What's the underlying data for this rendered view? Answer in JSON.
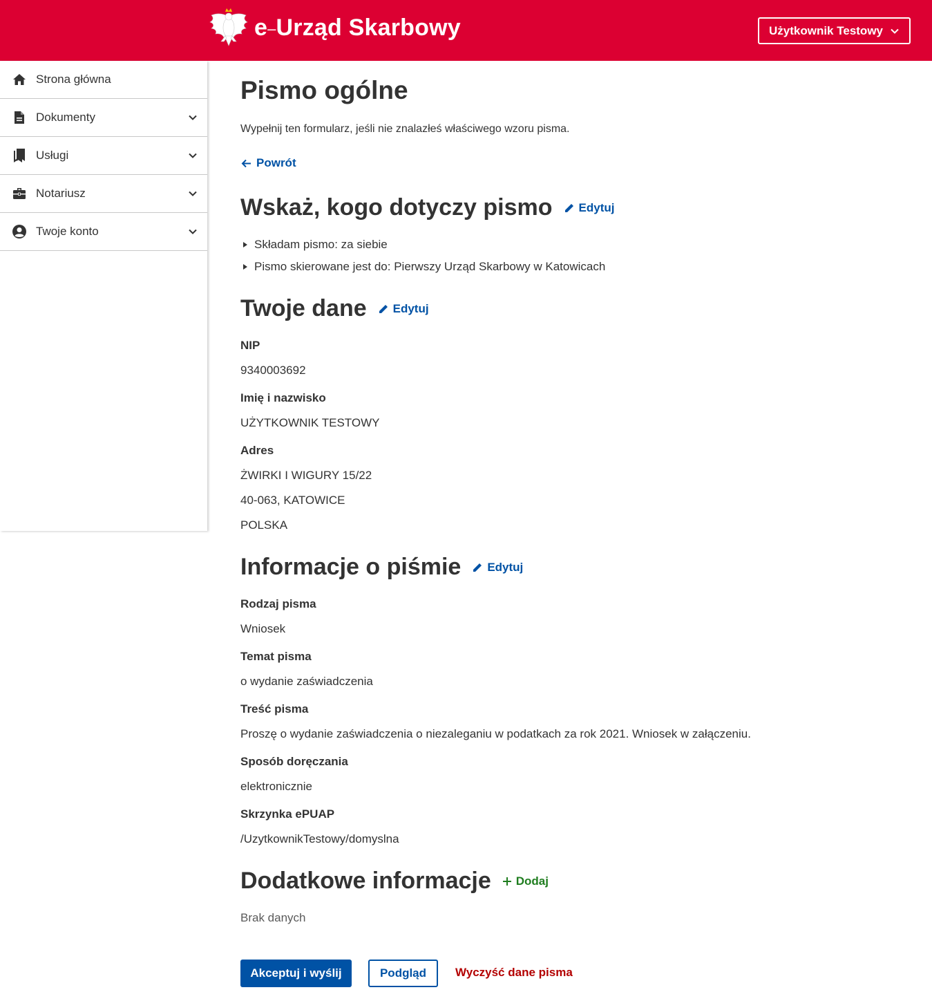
{
  "header": {
    "brand_prefix": "e",
    "brand_dash": "–",
    "brand_name": "Urząd Skarbowy",
    "user_button_label": "Użytkownik Testowy",
    "brand_color": "#dc0032"
  },
  "sidebar": {
    "items": [
      {
        "label": "Strona główna",
        "icon": "home-icon",
        "expandable": false
      },
      {
        "label": "Dokumenty",
        "icon": "document-icon",
        "expandable": true
      },
      {
        "label": "Usługi",
        "icon": "bookmarks-icon",
        "expandable": true
      },
      {
        "label": "Notariusz",
        "icon": "briefcase-icon",
        "expandable": true
      },
      {
        "label": "Twoje konto",
        "icon": "account-icon",
        "expandable": true
      }
    ]
  },
  "main": {
    "title": "Pismo ogólne",
    "lead": "Wypełnij ten formularz, jeśli nie znalazłeś właściwego wzoru pisma.",
    "back_label": "Powrót",
    "section_recipient": {
      "heading": "Wskaż, kogo dotyczy pismo",
      "edit_label": "Edytuj",
      "bullets": [
        "Składam pismo: za siebie",
        "Pismo skierowane jest do: Pierwszy Urząd Skarbowy w Katowicach"
      ]
    },
    "section_data": {
      "heading": "Twoje dane",
      "edit_label": "Edytuj",
      "nip_label": "NIP",
      "nip_value": "9340003692",
      "name_label": "Imię i nazwisko",
      "name_value": "UŻYTKOWNIK TESTOWY",
      "address_label": "Adres",
      "address_line1": "ŻWIRKI I WIGURY 15/22",
      "address_line2": "40-063, KATOWICE",
      "address_line3": "POLSKA"
    },
    "section_letter": {
      "heading": "Informacje o piśmie",
      "edit_label": "Edytuj",
      "type_label": "Rodzaj pisma",
      "type_value": "Wniosek",
      "subject_label": "Temat pisma",
      "subject_value": "o wydanie zaświadczenia",
      "content_label": "Treść pisma",
      "content_value": "Proszę o wydanie zaświadczenia o niezaleganiu w podatkach za rok 2021. Wniosek w załączeniu.",
      "delivery_label": "Sposób doręczania",
      "delivery_value": "elektronicznie",
      "epuap_label": "Skrzynka ePUAP",
      "epuap_value": "/UzytkownikTestowy/domyslna"
    },
    "section_extra": {
      "heading": "Dodatkowe informacje",
      "add_label": "Dodaj",
      "empty_text": "Brak danych"
    },
    "actions": {
      "accept_label": "Akceptuj i wyślij",
      "preview_label": "Podgląd",
      "clear_label": "Wyczyść dane pisma"
    }
  }
}
